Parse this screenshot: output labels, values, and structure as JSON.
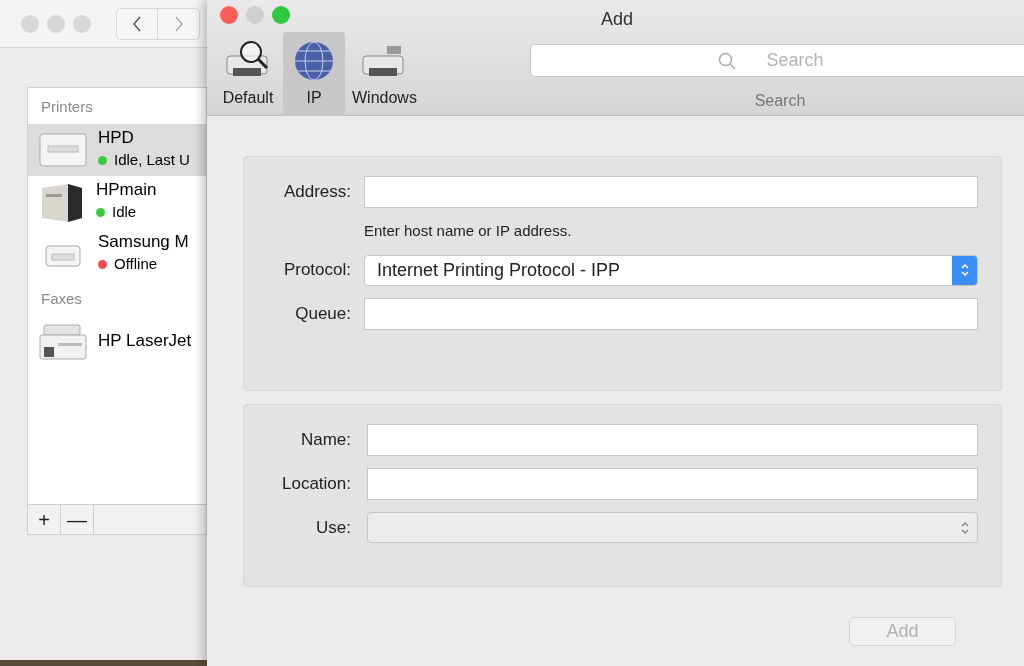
{
  "back_window": {
    "sidebar": {
      "sections": [
        {
          "title": "Printers",
          "items": [
            {
              "name": "HPD",
              "status": "Idle, Last U",
              "color": "#3ec83e",
              "selected": true,
              "kind": "laser"
            },
            {
              "name": "HPmain",
              "status": "Idle",
              "color": "#3ec83e",
              "selected": false,
              "kind": "office"
            },
            {
              "name": "Samsung M",
              "status": "Offline",
              "color": "#f04b4b",
              "selected": false,
              "kind": "small"
            }
          ]
        },
        {
          "title": "Faxes",
          "items": [
            {
              "name": "HP LaserJet",
              "selected": false,
              "kind": "fax"
            }
          ]
        }
      ],
      "buttons": [
        "+",
        "—"
      ]
    }
  },
  "window": {
    "title": "Add",
    "tabs": [
      {
        "label": "Default",
        "selected": false,
        "kind": "default"
      },
      {
        "label": "IP",
        "selected": true,
        "kind": "ip"
      },
      {
        "label": "Windows",
        "selected": false,
        "kind": "windows"
      }
    ],
    "search": {
      "placeholder": "Search",
      "label": "Search"
    },
    "groups": [
      {
        "fields": [
          {
            "label": "Address:",
            "kind": "text",
            "hint": "Enter host name or IP address."
          },
          {
            "label": "Protocol:",
            "kind": "select",
            "value": "Internet Printing Protocol - IPP",
            "disabled": false
          },
          {
            "label": "Queue:",
            "kind": "text"
          }
        ]
      },
      {
        "fields": [
          {
            "label": "Name:",
            "kind": "text"
          },
          {
            "label": "Location:",
            "kind": "text"
          },
          {
            "label": "Use:",
            "kind": "select",
            "disabled": true
          }
        ]
      }
    ],
    "add_button": {
      "label": "Add",
      "disabled": true
    }
  }
}
